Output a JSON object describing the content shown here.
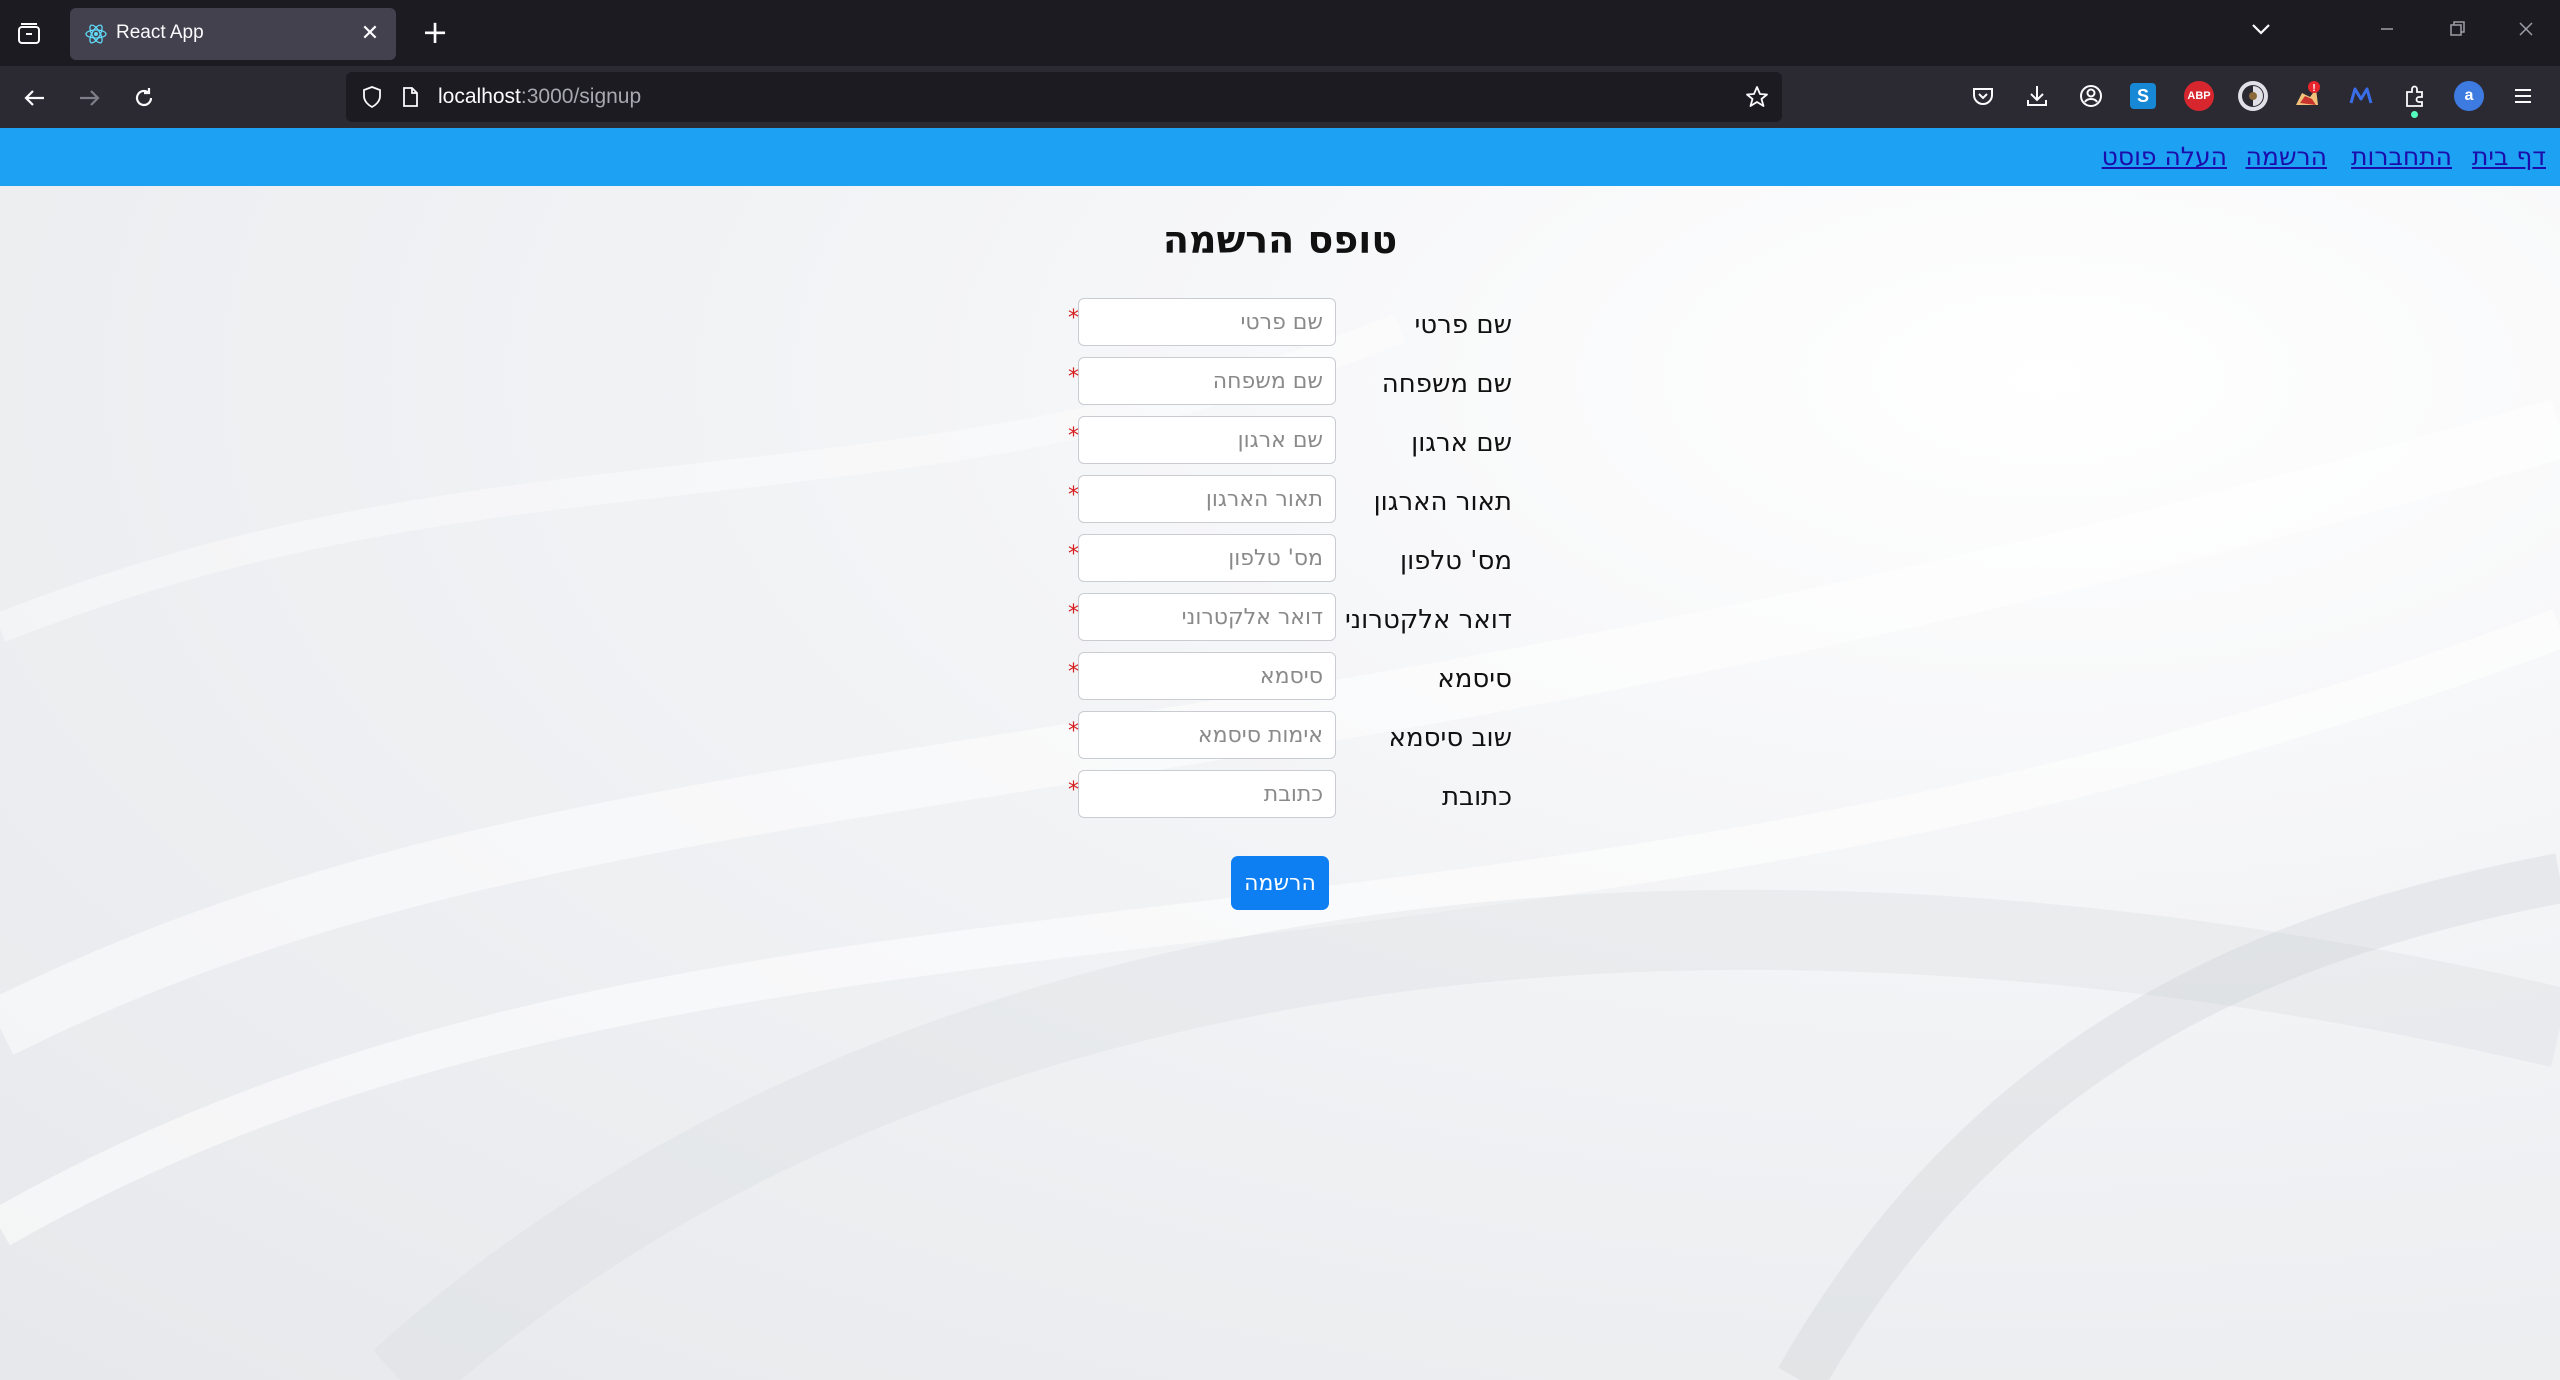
{
  "browser": {
    "tab": {
      "title": "React App"
    },
    "url": {
      "host": "localhost",
      "rest": ":3000/signup"
    }
  },
  "site_nav": {
    "links": [
      "דף בית",
      "התחברות",
      "הרשמה",
      "העלה פוסט"
    ]
  },
  "form": {
    "title": "טופס הרשמה",
    "required_mark": "*",
    "fields": [
      {
        "label": "שם פרטי",
        "placeholder": "שם פרטי"
      },
      {
        "label": "שם משפחה",
        "placeholder": "שם משפחה"
      },
      {
        "label": "שם ארגון",
        "placeholder": "שם ארגון"
      },
      {
        "label": "תאור הארגון",
        "placeholder": "תאור הארגון"
      },
      {
        "label": "מס' טלפון",
        "placeholder": "מס' טלפון"
      },
      {
        "label": "דואר אלקטרוני",
        "placeholder": "דואר אלקטרוני"
      },
      {
        "label": "סיסמא",
        "placeholder": "סיסמא"
      },
      {
        "label": "שוב סיסמא",
        "placeholder": "אימות סיסמא"
      },
      {
        "label": "כתובת",
        "placeholder": "כתובת"
      }
    ],
    "submit_label": "הרשמה"
  },
  "colors": {
    "site_nav_bg": "#1da1f2",
    "link": "#1a0dab",
    "submit_bg": "#0d7ff2",
    "required": "#d61f1f"
  },
  "extensions": [
    "pocket-icon",
    "download-icon",
    "account-icon",
    "s-extension-icon",
    "abp-icon",
    "privacy-badger-icon",
    "alert-extension-icon",
    "m-extension-icon",
    "puzzle-icon",
    "a-extension-icon",
    "menu-icon"
  ]
}
